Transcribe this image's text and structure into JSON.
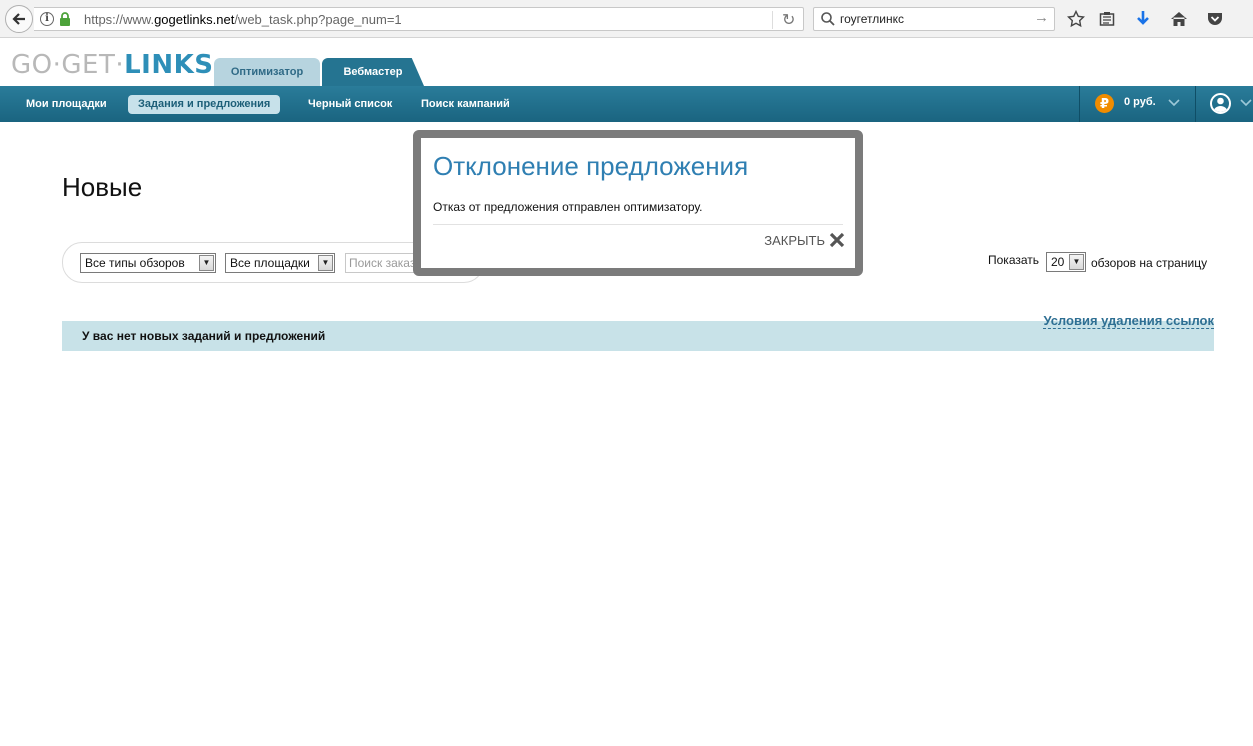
{
  "browser": {
    "url_prefix": "https://www.",
    "url_domain": "gogetlinks.net",
    "url_path": "/web_task.php?page_num=1",
    "search_query": "гоугетлинкс"
  },
  "header": {
    "logo_part1": "GO·GET·",
    "logo_part2": "LINKS",
    "tabs": [
      {
        "label": "Оптимизатор"
      },
      {
        "label": "Вебмастер"
      }
    ]
  },
  "nav": {
    "items": [
      {
        "label": "Мои площадки"
      },
      {
        "label": "Задания и предложения"
      },
      {
        "label": "Черный список"
      },
      {
        "label": "Поиск кампаний"
      }
    ],
    "balance": "0 руб."
  },
  "main": {
    "title": "Новые",
    "filters": {
      "type_select": "Все типы обзоров",
      "site_select": "Все площадки",
      "search_placeholder": "Поиск заказа"
    },
    "perpage": {
      "label_before": "Показать",
      "value": "20",
      "label_after": "обзоров на страницу"
    },
    "terms_link": "Условия удаления ссылок",
    "empty_message": "У вас нет новых заданий и предложений"
  },
  "modal": {
    "title": "Отклонение предложения",
    "message": "Отказ от предложения отправлен оптимизатору.",
    "close_label": "ЗАКРЫТЬ"
  },
  "colors": {
    "accent": "#2e8fb8",
    "nav_bg": "#1f6d8a",
    "rub": "#f08c00"
  }
}
